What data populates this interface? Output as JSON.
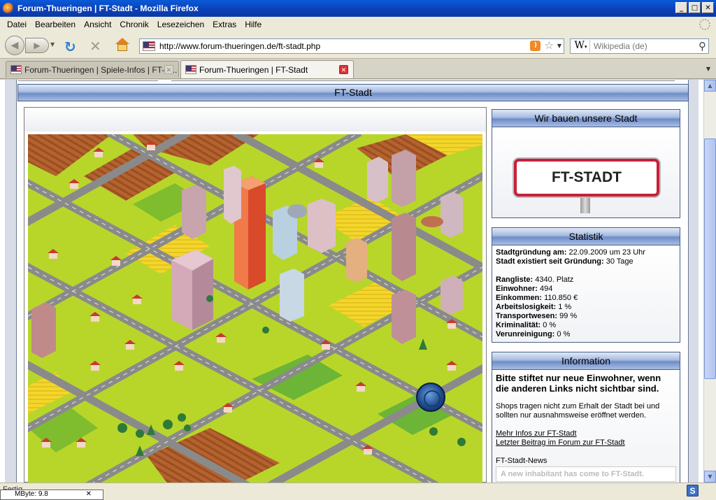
{
  "window": {
    "title": "Forum-Thueringen | FT-Stadt - Mozilla Firefox",
    "buttons": {
      "minimize": "_",
      "maximize": "□",
      "close": "✕"
    }
  },
  "menu": [
    "Datei",
    "Bearbeiten",
    "Ansicht",
    "Chronik",
    "Lesezeichen",
    "Extras",
    "Hilfe"
  ],
  "nav": {
    "url": "http://www.forum-thueringen.de/ft-stadt.php",
    "search_engine": "W",
    "search_placeholder": "Wikipedia (de)"
  },
  "tabs": [
    {
      "label": "Forum-Thueringen | Spiele-Infos | FT-S...",
      "active": false
    },
    {
      "label": "Forum-Thueringen | FT-Stadt",
      "active": true
    }
  ],
  "page": {
    "header": "FT-Stadt",
    "build_box": {
      "title": "Wir bauen unsere Stadt",
      "sign_text": "FT-STADT"
    },
    "stats": {
      "title": "Statistik",
      "rows_top": [
        {
          "label": "Stadtgründung am:",
          "value": "22.09.2009 um 23 Uhr"
        },
        {
          "label": "Stadt existiert seit Gründung:",
          "value": "30 Tage"
        }
      ],
      "rows_bottom": [
        {
          "label": "Rangliste:",
          "value": "4340. Platz"
        },
        {
          "label": "Einwohner:",
          "value": "494"
        },
        {
          "label": "Einkommen:",
          "value": "110.850 €"
        },
        {
          "label": "Arbeitslosigkeit:",
          "value": "1 %"
        },
        {
          "label": "Transportwesen:",
          "value": "99 %"
        },
        {
          "label": "Kriminalität:",
          "value": "0 %"
        },
        {
          "label": "Verunreinigung:",
          "value": "0 %"
        }
      ]
    },
    "info": {
      "title": "Information",
      "headline": "Bitte stiftet nur neue Einwohner, wenn die anderen Links nicht sichtbar sind.",
      "text": "Shops tragen nicht zum Erhalt der Stadt bei und sollten nur ausnahmsweise eröffnet werden.",
      "link1": "Mehr Infos zur FT-Stadt",
      "link2": "Letzter Beitrag im Forum zur FT-Stadt",
      "news_label": "FT-Stadt-News",
      "news_text": "A new inhabitant has come to FT-Stadt."
    }
  },
  "status": {
    "text": "Fertig",
    "mbyte": "MByte: 9.8"
  },
  "colors": {
    "title_bar": "#0b3fb6",
    "grass": "#b8d62a",
    "road": "#8a8a8a",
    "sign_red": "#c7203a"
  }
}
